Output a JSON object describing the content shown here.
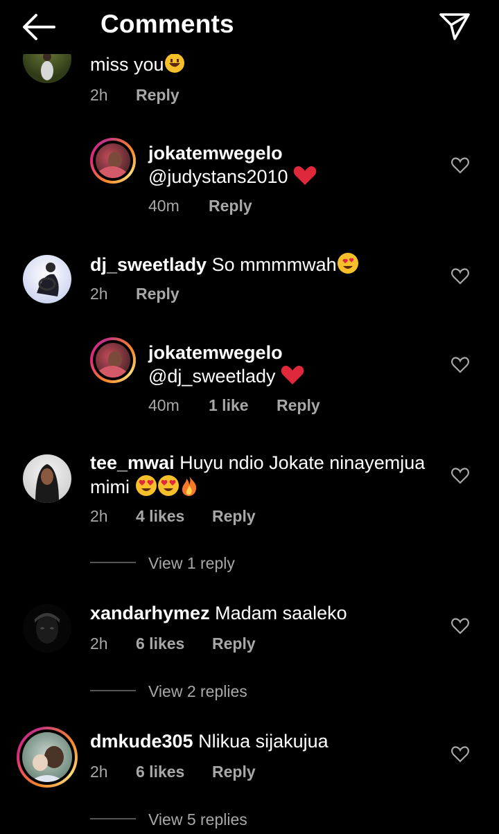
{
  "header": {
    "title": "Comments"
  },
  "partial_comment": {
    "text": "miss you",
    "time": "2h",
    "reply": "Reply"
  },
  "comments": [
    {
      "user": "jokatemwegelo",
      "text": "@judystans2010",
      "time": "40m",
      "reply": "Reply"
    },
    {
      "user": "dj_sweetlady",
      "text": "So mmmmwah",
      "time": "2h",
      "reply": "Reply"
    },
    {
      "user": "jokatemwegelo",
      "text": "@dj_sweetlady",
      "time": "40m",
      "likes": "1 like",
      "reply": "Reply"
    },
    {
      "user": "tee_mwai",
      "text": "Huyu ndio Jokate ninayemjua",
      "text2": "mimi",
      "time": "2h",
      "likes": "4 likes",
      "reply": "Reply",
      "view_replies": "View 1 reply"
    },
    {
      "user": "xandarhymez",
      "text": "Madam saaleko",
      "time": "2h",
      "likes": "6 likes",
      "reply": "Reply",
      "view_replies": "View 2 replies"
    },
    {
      "user": "dmkude305",
      "text": "Nlikua sijakujua",
      "time": "2h",
      "likes": "6 likes",
      "reply": "Reply",
      "view_replies": "View 5 replies"
    }
  ],
  "icons": {
    "back": "arrow-left-icon",
    "send": "paper-plane-icon",
    "like": "heart-outline-icon"
  },
  "colors": {
    "background": "#000000",
    "text": "#ffffff",
    "muted": "#a8a8a8",
    "heart_red": "#e0283c"
  }
}
